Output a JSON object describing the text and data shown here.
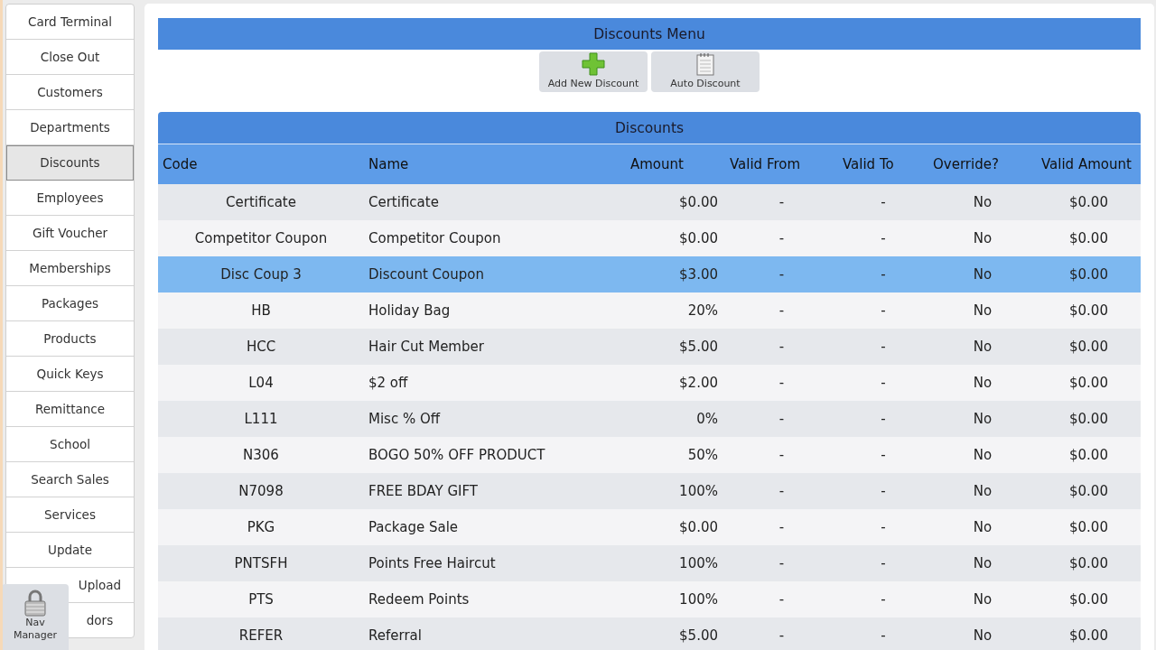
{
  "sidebar": {
    "items": [
      {
        "label": "Card Terminal",
        "selected": false
      },
      {
        "label": "Close Out",
        "selected": false
      },
      {
        "label": "Customers",
        "selected": false
      },
      {
        "label": "Departments",
        "selected": false
      },
      {
        "label": "Discounts",
        "selected": true
      },
      {
        "label": "Employees",
        "selected": false
      },
      {
        "label": "Gift Voucher",
        "selected": false
      },
      {
        "label": "Memberships",
        "selected": false
      },
      {
        "label": "Packages",
        "selected": false
      },
      {
        "label": "Products",
        "selected": false
      },
      {
        "label": "Quick Keys",
        "selected": false
      },
      {
        "label": "Remittance",
        "selected": false
      },
      {
        "label": "School",
        "selected": false
      },
      {
        "label": "Search Sales",
        "selected": false
      },
      {
        "label": "Services",
        "selected": false
      },
      {
        "label": "Update",
        "selected": false
      },
      {
        "label": "Upload",
        "selected": false
      },
      {
        "label": "dors",
        "selected": false
      }
    ],
    "nav_manager": {
      "label": "Nav Manager"
    }
  },
  "menu": {
    "title": "Discounts Menu",
    "buttons": [
      {
        "label": "Add New Discount",
        "kind": "add"
      },
      {
        "label": "Auto Discount",
        "kind": "notepad"
      }
    ]
  },
  "table": {
    "title": "Discounts",
    "columns": [
      "Code",
      "Name",
      "Amount",
      "Valid From",
      "Valid To",
      "Override?",
      "Valid Amount"
    ],
    "rows": [
      {
        "cells": [
          "Certificate",
          "Certificate",
          "$0.00",
          "-",
          "-",
          "No",
          "$0.00"
        ],
        "selected": false
      },
      {
        "cells": [
          "Competitor Coupon",
          "Competitor Coupon",
          "$0.00",
          "-",
          "-",
          "No",
          "$0.00"
        ],
        "selected": false
      },
      {
        "cells": [
          "Disc Coup 3",
          "Discount Coupon",
          "$3.00",
          "-",
          "-",
          "No",
          "$0.00"
        ],
        "selected": true
      },
      {
        "cells": [
          "HB",
          "Holiday Bag",
          "20%",
          "-",
          "-",
          "No",
          "$0.00"
        ],
        "selected": false
      },
      {
        "cells": [
          "HCC",
          "Hair Cut Member",
          "$5.00",
          "-",
          "-",
          "No",
          "$0.00"
        ],
        "selected": false
      },
      {
        "cells": [
          "L04",
          "$2 off",
          "$2.00",
          "-",
          "-",
          "No",
          "$0.00"
        ],
        "selected": false
      },
      {
        "cells": [
          "L111",
          "Misc % Off",
          "0%",
          "-",
          "-",
          "No",
          "$0.00"
        ],
        "selected": false
      },
      {
        "cells": [
          "N306",
          "BOGO 50% OFF PRODUCT",
          "50%",
          "-",
          "-",
          "No",
          "$0.00"
        ],
        "selected": false
      },
      {
        "cells": [
          "N7098",
          "FREE BDAY GIFT",
          "100%",
          "-",
          "-",
          "No",
          "$0.00"
        ],
        "selected": false
      },
      {
        "cells": [
          "PKG",
          "Package Sale",
          "$0.00",
          "-",
          "-",
          "No",
          "$0.00"
        ],
        "selected": false
      },
      {
        "cells": [
          "PNTSFH",
          "Points Free Haircut",
          "100%",
          "-",
          "-",
          "No",
          "$0.00"
        ],
        "selected": false
      },
      {
        "cells": [
          "PTS",
          "Redeem Points",
          "100%",
          "-",
          "-",
          "No",
          "$0.00"
        ],
        "selected": false
      },
      {
        "cells": [
          "REFER",
          "Referral",
          "$5.00",
          "-",
          "-",
          "No",
          "$0.00"
        ],
        "selected": false
      }
    ]
  }
}
